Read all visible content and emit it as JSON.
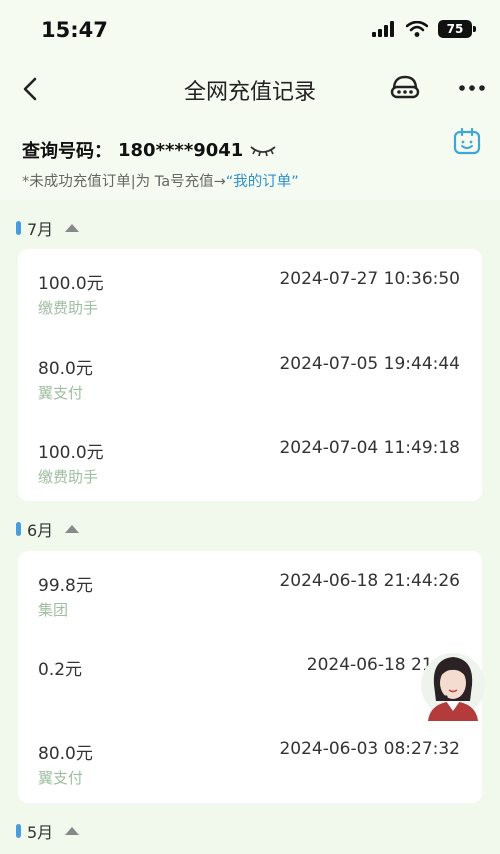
{
  "status_bar": {
    "time": "15:47",
    "battery": "75"
  },
  "nav": {
    "title": "全网充值记录"
  },
  "query": {
    "label": "查询号码：",
    "number": "180****9041"
  },
  "note": {
    "text": "*未成功充值订单|为 Ta号充值→",
    "link": "“我的订单”"
  },
  "months": [
    {
      "label": "7月",
      "records": [
        {
          "amount": "100.0元",
          "date": "2024-07-27 10:36:50",
          "source": "缴费助手"
        },
        {
          "amount": "80.0元",
          "date": "2024-07-05 19:44:44",
          "source": "翼支付"
        },
        {
          "amount": "100.0元",
          "date": "2024-07-04 11:49:18",
          "source": "缴费助手"
        }
      ]
    },
    {
      "label": "6月",
      "records": [
        {
          "amount": "99.8元",
          "date": "2024-06-18 21:44:26",
          "source": "集团"
        },
        {
          "amount": "0.2元",
          "date": "2024-06-18 21:44",
          "source": ""
        },
        {
          "amount": "80.0元",
          "date": "2024-06-03 08:27:32",
          "source": "翼支付"
        }
      ]
    },
    {
      "label": "5月",
      "records": []
    }
  ]
}
